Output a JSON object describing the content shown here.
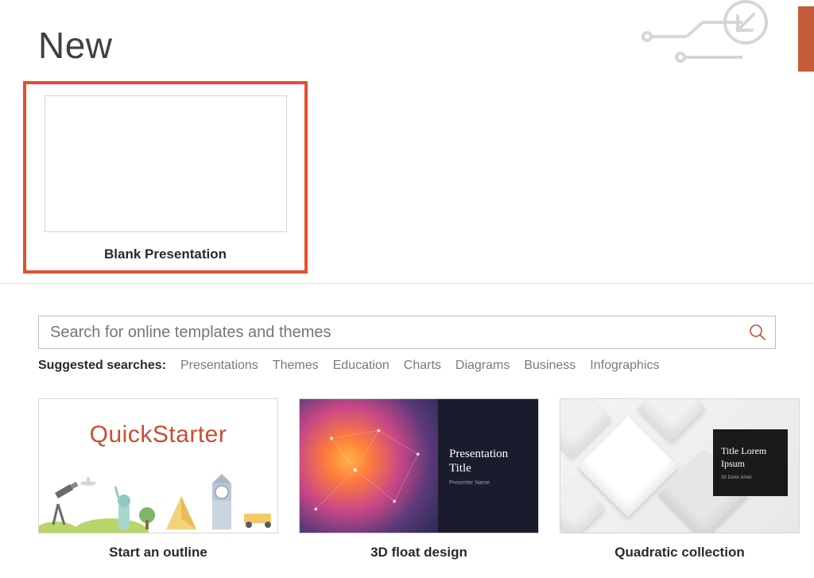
{
  "heading": "New",
  "blank": {
    "label": "Blank Presentation"
  },
  "search": {
    "placeholder": "Search for online templates and themes"
  },
  "suggested": {
    "label": "Suggested searches:",
    "items": [
      "Presentations",
      "Themes",
      "Education",
      "Charts",
      "Diagrams",
      "Business",
      "Infographics"
    ]
  },
  "templates": [
    {
      "id": "quickstarter",
      "label": "Start an outline",
      "thumb_text": "QuickStarter"
    },
    {
      "id": "3d-float",
      "label": "3D float design",
      "thumb_title_line1": "Presentation",
      "thumb_title_line2": "Title",
      "thumb_subtitle": "Presenter Name"
    },
    {
      "id": "quadratic",
      "label": "Quadratic collection",
      "thumb_title_line1": "Title Lorem",
      "thumb_title_line2": "Ipsum",
      "thumb_subtitle": "Sit Dolor Amet"
    }
  ],
  "colors": {
    "accent": "#c94d30",
    "highlight": "#e74c2f"
  }
}
